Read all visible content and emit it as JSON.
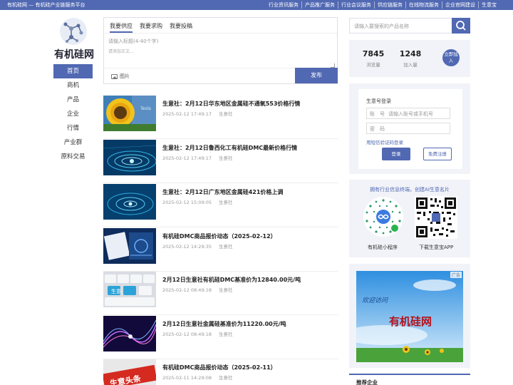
{
  "topbar": {
    "site": "有机硅网 — 有机硅产业链服务平台",
    "links": [
      "行业资讯服务",
      "产品推广服务",
      "行业会议服务",
      "供应链服务",
      "在线物流服务",
      "企业官网建设",
      "生意宝"
    ]
  },
  "logo": {
    "title": "有机硅网"
  },
  "nav": [
    "首页",
    "商机",
    "产品",
    "企业",
    "行情",
    "产业群",
    "原料交易"
  ],
  "post": {
    "tabs": [
      "我要供应",
      "我要求购",
      "我要投稿"
    ],
    "title_placeholder": "请输入标题(4-40个字)",
    "body_placeholder": "请添加正文...",
    "image_label": "图片",
    "publish": "发布"
  },
  "news": [
    {
      "title": "生意社：2月12日华东地区金属硅不通氧553价格行情",
      "date": "2025-02-12 17:49:17",
      "source": "生意社",
      "thumb_text": "Tesla"
    },
    {
      "title": "生意社：2月12日鲁西化工有机硅DMC最新价格行情",
      "date": "2025-02-12 17:49:17",
      "source": "生意社"
    },
    {
      "title": "生意社：2月12日广东地区金属硅421价格上调",
      "date": "2025-02-12 15:09:05",
      "source": "生意社"
    },
    {
      "title": "有机硅DMC商品报价动态（2025-02-12）",
      "date": "2025-02-12 14:29:35",
      "source": "生意社"
    },
    {
      "title": "2月12日生意社有机硅DMC基准价为12840.00元/吨",
      "date": "2025-02-12 08:49:18",
      "source": "生意社",
      "thumb_text": "生意"
    },
    {
      "title": "2月12日生意社金属硅基准价为11220.00元/吨",
      "date": "2025-02-12 08:49:18",
      "source": "生意社"
    },
    {
      "title": "有机硅DMC商品报价动态（2025-02-11）",
      "date": "2025-02-11 14:29:08",
      "source": "生意社",
      "thumb_text": "生意头条"
    }
  ],
  "search": {
    "placeholder": "请输入要搜索的产品名称"
  },
  "stats": {
    "views": "7845",
    "views_label": "浏览量",
    "joined": "1248",
    "joined_label": "加入量",
    "join_now": "立即加入"
  },
  "login": {
    "title": "生意号登录",
    "account_label": "账　号",
    "account_placeholder": "请输入账号或手机号",
    "password_label": "密　码",
    "sms_link": "用短信验证码登录",
    "login_button": "登录",
    "register_button": "免费注册"
  },
  "promo": {
    "headline": "拥有行业信息终端，创建AI生意名片",
    "mini_program": "有机硅小程序",
    "app_download": "下载生意宝APP"
  },
  "ad": {
    "tag": "广告",
    "welcome": "欢迎访问",
    "brand": "有机硅网"
  },
  "recommended": {
    "title": "推荐企业"
  },
  "colors": {
    "brand": "#5168b3",
    "panel": "#f1f3f8"
  }
}
